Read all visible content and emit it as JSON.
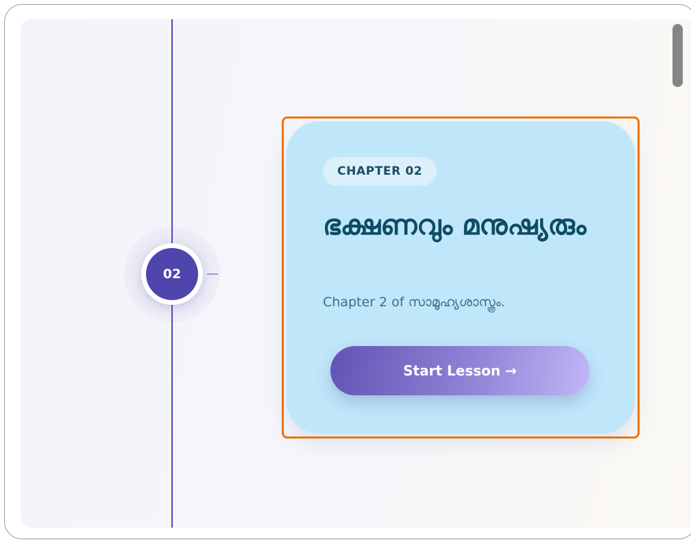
{
  "timeline": {
    "node_label": "02"
  },
  "card": {
    "chip_label": "CHAPTER 02",
    "title": "ഭക്ഷണവും മനുഷ്യരും",
    "subtitle": "Chapter 2 of സാമൂഹ്യശാസ്ത്രം.",
    "cta_label": "Start Lesson →"
  },
  "colors": {
    "timeline": "#4f46b8",
    "node": "#4e45ad",
    "card_background": "#c0e6f9",
    "highlight": "#f27405",
    "title": "#0d4c63"
  }
}
